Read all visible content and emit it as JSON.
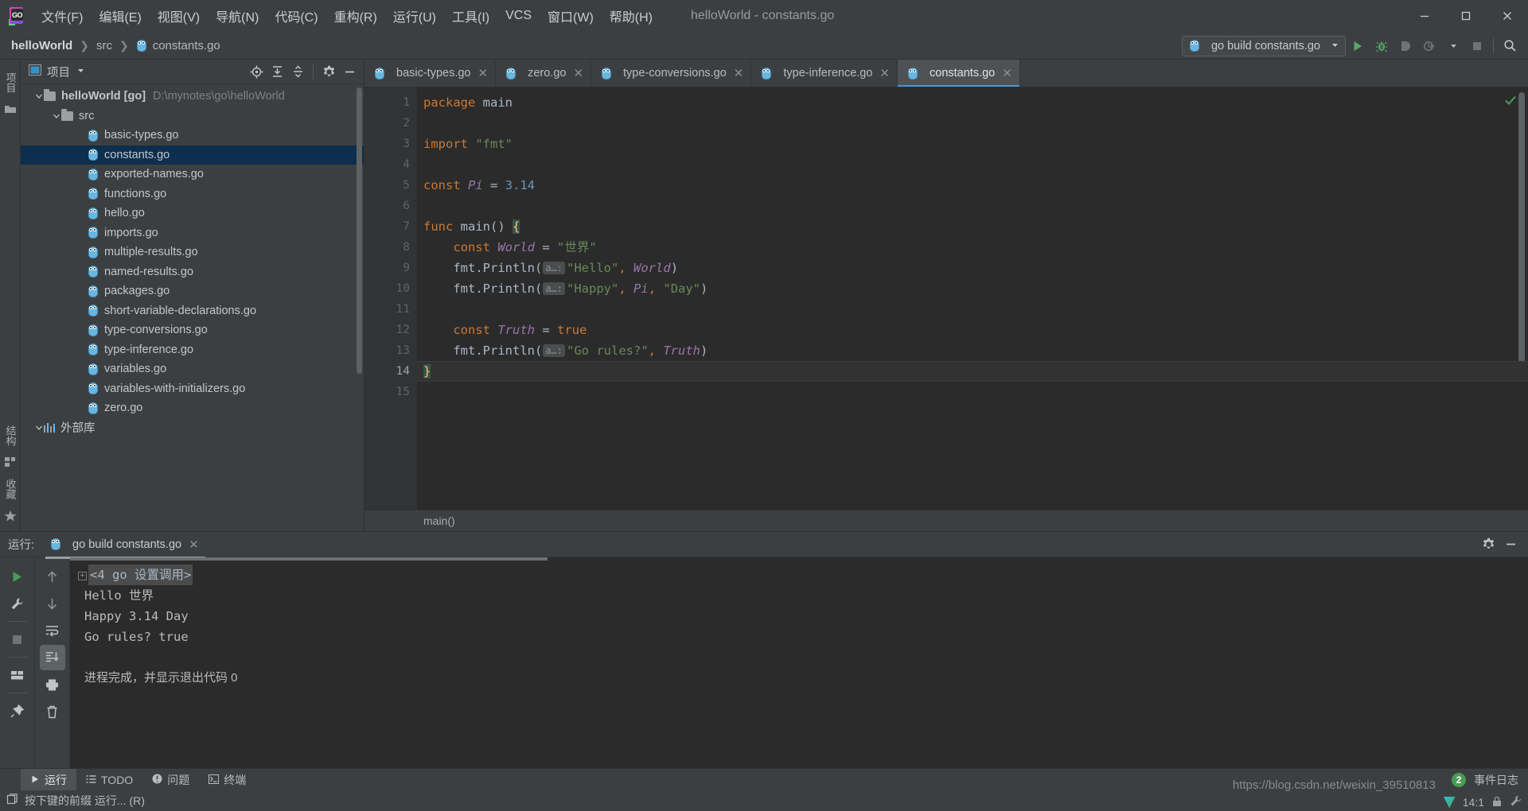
{
  "window": {
    "title": "helloWorld - constants.go",
    "menu": [
      {
        "label": "文件(F)",
        "mnemonic": "F"
      },
      {
        "label": "编辑(E)",
        "mnemonic": "E"
      },
      {
        "label": "视图(V)",
        "mnemonic": "V"
      },
      {
        "label": "导航(N)",
        "mnemonic": "N"
      },
      {
        "label": "代码(C)",
        "mnemonic": "C"
      },
      {
        "label": "重构(R)",
        "mnemonic": "R"
      },
      {
        "label": "运行(U)",
        "mnemonic": "U"
      },
      {
        "label": "工具(I)",
        "mnemonic": "I"
      },
      {
        "label": "VCS",
        "mnemonic": ""
      },
      {
        "label": "窗口(W)",
        "mnemonic": "W"
      },
      {
        "label": "帮助(H)",
        "mnemonic": "H"
      }
    ]
  },
  "navbar": {
    "breadcrumb": [
      "helloWorld",
      "src",
      "constants.go"
    ],
    "run_configuration": "go build constants.go"
  },
  "project_panel": {
    "title": "项目",
    "rail_label": "项目",
    "tree": [
      {
        "label": "helloWorld [go]",
        "path": "D:\\mynotes\\go\\helloWorld",
        "type": "folder",
        "depth": 0,
        "expanded": true,
        "selected": false
      },
      {
        "label": "src",
        "path": "",
        "type": "folder",
        "depth": 1,
        "expanded": true,
        "selected": false
      },
      {
        "label": "basic-types.go",
        "path": "",
        "type": "go",
        "depth": 2,
        "selected": false
      },
      {
        "label": "constants.go",
        "path": "",
        "type": "go",
        "depth": 2,
        "selected": true
      },
      {
        "label": "exported-names.go",
        "path": "",
        "type": "go",
        "depth": 2,
        "selected": false
      },
      {
        "label": "functions.go",
        "path": "",
        "type": "go",
        "depth": 2,
        "selected": false
      },
      {
        "label": "hello.go",
        "path": "",
        "type": "go",
        "depth": 2,
        "selected": false
      },
      {
        "label": "imports.go",
        "path": "",
        "type": "go",
        "depth": 2,
        "selected": false
      },
      {
        "label": "multiple-results.go",
        "path": "",
        "type": "go",
        "depth": 2,
        "selected": false
      },
      {
        "label": "named-results.go",
        "path": "",
        "type": "go",
        "depth": 2,
        "selected": false
      },
      {
        "label": "packages.go",
        "path": "",
        "type": "go",
        "depth": 2,
        "selected": false
      },
      {
        "label": "short-variable-declarations.go",
        "path": "",
        "type": "go",
        "depth": 2,
        "selected": false
      },
      {
        "label": "type-conversions.go",
        "path": "",
        "type": "go",
        "depth": 2,
        "selected": false
      },
      {
        "label": "type-inference.go",
        "path": "",
        "type": "go",
        "depth": 2,
        "selected": false
      },
      {
        "label": "variables.go",
        "path": "",
        "type": "go",
        "depth": 2,
        "selected": false
      },
      {
        "label": "variables-with-initializers.go",
        "path": "",
        "type": "go",
        "depth": 2,
        "selected": false
      },
      {
        "label": "zero.go",
        "path": "",
        "type": "go",
        "depth": 2,
        "selected": false
      },
      {
        "label": "外部库",
        "path": "",
        "type": "libs",
        "depth": 0,
        "expanded": true,
        "selected": false
      }
    ]
  },
  "editor": {
    "tabs": [
      {
        "label": "basic-types.go",
        "active": false
      },
      {
        "label": "zero.go",
        "active": false
      },
      {
        "label": "type-conversions.go",
        "active": false
      },
      {
        "label": "type-inference.go",
        "active": false
      },
      {
        "label": "constants.go",
        "active": true
      }
    ],
    "line_numbers": [
      "1",
      "2",
      "3",
      "4",
      "5",
      "6",
      "7",
      "8",
      "9",
      "10",
      "11",
      "12",
      "13",
      "14",
      "15"
    ],
    "current_line": 14,
    "code_lines": [
      "package main",
      "",
      "import \"fmt\"",
      "",
      "const Pi = 3.14",
      "",
      "func main() {",
      "    const World = \"世界\"",
      "    fmt.Println( a…: \"Hello\", World)",
      "    fmt.Println( a…: \"Happy\", Pi, \"Day\")",
      "",
      "    const Truth = true",
      "    fmt.Println( a…: \"Go rules?\", Truth)",
      "}",
      ""
    ],
    "param_hint": "a…:",
    "breadcrumb_bottom": "main()"
  },
  "run_panel": {
    "label": "运行:",
    "tab_title": "go build constants.go",
    "console": [
      "<4 go 设置调用>",
      "Hello 世界",
      "Happy 3.14 Day",
      "Go rules? true",
      "",
      "进程完成，并显示退出代码 0"
    ],
    "console_command": "<4 go 设置调用>"
  },
  "statusbar": {
    "tabs": [
      {
        "label": "运行",
        "icon": "play-icon",
        "active": true
      },
      {
        "label": "TODO",
        "icon": "list-icon",
        "active": false
      },
      {
        "label": "问题",
        "icon": "warning-icon",
        "active": false
      },
      {
        "label": "终端",
        "icon": "terminal-icon",
        "active": false
      }
    ],
    "event_log": "事件日志",
    "event_log_count": "2",
    "hint": "按下键的前缀 运行... (R)",
    "caret_position": "14:1",
    "watermark": "https://blog.csdn.net/weixin_39510813"
  },
  "rail": {
    "left_labels": [
      "项目",
      "结构",
      "收藏"
    ]
  },
  "colors": {
    "accent": "#4f94d4",
    "selection": "#0d2e4e",
    "keyword": "#cc7832",
    "string": "#6a8759",
    "number": "#6897bb",
    "constant": "#9876aa",
    "editor_bg": "#2b2b2b",
    "panel_bg": "#3c3f41",
    "green": "#499c54"
  }
}
